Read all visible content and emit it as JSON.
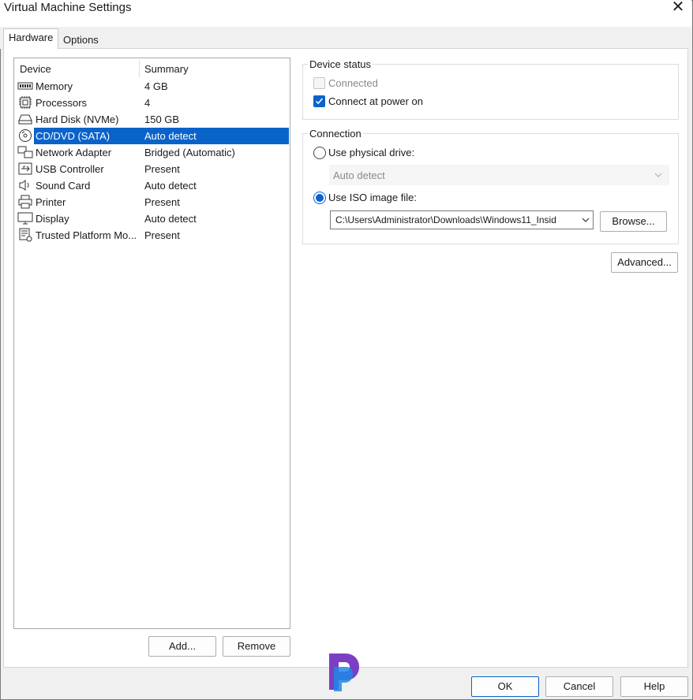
{
  "window": {
    "title": "Virtual Machine Settings"
  },
  "tabs": [
    {
      "label": "Hardware",
      "active": true
    },
    {
      "label": "Options",
      "active": false
    }
  ],
  "device_list": {
    "columns": {
      "device": "Device",
      "summary": "Summary"
    },
    "rows": [
      {
        "device": "Memory",
        "summary": "4 GB",
        "icon": "memory-icon"
      },
      {
        "device": "Processors",
        "summary": "4",
        "icon": "processor-icon"
      },
      {
        "device": "Hard Disk (NVMe)",
        "summary": "150 GB",
        "icon": "hard-disk-icon"
      },
      {
        "device": "CD/DVD (SATA)",
        "summary": "Auto detect",
        "icon": "cd-dvd-icon",
        "selected": true
      },
      {
        "device": "Network Adapter",
        "summary": "Bridged (Automatic)",
        "icon": "network-adapter-icon"
      },
      {
        "device": "USB Controller",
        "summary": "Present",
        "icon": "usb-icon"
      },
      {
        "device": "Sound Card",
        "summary": "Auto detect",
        "icon": "speaker-icon"
      },
      {
        "device": "Printer",
        "summary": "Present",
        "icon": "printer-icon"
      },
      {
        "device": "Display",
        "summary": "Auto detect",
        "icon": "monitor-icon"
      },
      {
        "device": "Trusted Platform Mo...",
        "summary": "Present",
        "icon": "tpm-icon"
      }
    ]
  },
  "list_buttons": {
    "add": "Add...",
    "remove": "Remove"
  },
  "device_status": {
    "title": "Device status",
    "connected": {
      "label": "Connected",
      "checked": false,
      "disabled": true
    },
    "connect_at_power_on": {
      "label": "Connect at power on",
      "checked": true
    }
  },
  "connection": {
    "title": "Connection",
    "physical_drive": {
      "label": "Use physical drive:",
      "selected": false,
      "dropdown_value": "Auto detect"
    },
    "iso_image": {
      "label": "Use ISO image file:",
      "selected": true,
      "path": "C:\\Users\\Administrator\\Downloads\\Windows11_Insid"
    },
    "browse_label": "Browse..."
  },
  "advanced_label": "Advanced...",
  "footer": {
    "ok": "OK",
    "cancel": "Cancel",
    "help": "Help"
  },
  "colors": {
    "accent": "#0a63c9",
    "logo_purple": "#7b3fc4",
    "logo_blue": "#1e88e5"
  }
}
